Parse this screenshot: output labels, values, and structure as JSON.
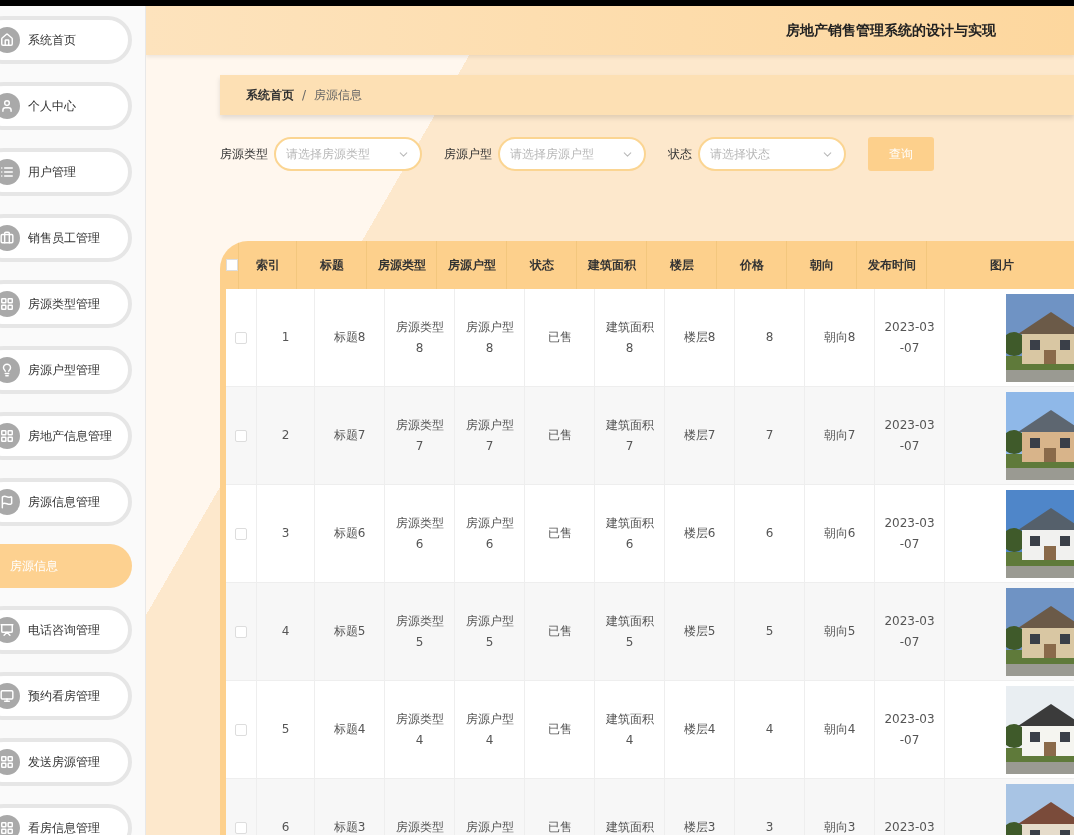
{
  "sidebar": {
    "items": [
      {
        "label": "系统首页",
        "selected": false
      },
      {
        "label": "个人中心",
        "selected": false
      },
      {
        "label": "用户管理",
        "selected": false
      },
      {
        "label": "销售员工管理",
        "selected": false
      },
      {
        "label": "房源类型管理",
        "selected": false
      },
      {
        "label": "房源户型管理",
        "selected": false
      },
      {
        "label": "房地产信息管理",
        "selected": false
      },
      {
        "label": "房源信息管理",
        "selected": false
      },
      {
        "label": "房源信息",
        "selected": true
      },
      {
        "label": "电话咨询管理",
        "selected": false
      },
      {
        "label": "预约看房管理",
        "selected": false
      },
      {
        "label": "发送房源管理",
        "selected": false
      },
      {
        "label": "看房信息管理",
        "selected": false
      }
    ]
  },
  "header": {
    "title": "房地产销售管理系统的设计与实现"
  },
  "breadcrumb": {
    "items": [
      "系统首页",
      "房源信息"
    ],
    "separator": "/"
  },
  "filters": [
    {
      "label": "房源类型",
      "placeholder": "请选择房源类型"
    },
    {
      "label": "房源户型",
      "placeholder": "请选择房源户型"
    },
    {
      "label": "状态",
      "placeholder": "请选择状态"
    }
  ],
  "search_button": "查询",
  "table": {
    "select_all_checked": false,
    "columns": [
      "索引",
      "标题",
      "房源类型",
      "房源户型",
      "状态",
      "建筑面积",
      "楼层",
      "价格",
      "朝向",
      "发布时间",
      "图片"
    ],
    "rows": [
      {
        "checked": false,
        "cells": [
          "1",
          "标题8",
          "房源类型8",
          "房源户型8",
          "已售",
          "建筑面积8",
          "楼层8",
          "8",
          "朝向8",
          "2023-03-07"
        ],
        "image": {
          "kind": "picture"
        }
      },
      {
        "checked": false,
        "cells": [
          "2",
          "标题7",
          "房源类型7",
          "房源户型7",
          "已售",
          "建筑面积7",
          "楼层7",
          "7",
          "朝向7",
          "2023-03-07"
        ],
        "image": {
          "kind": "picture"
        }
      },
      {
        "checked": false,
        "cells": [
          "3",
          "标题6",
          "房源类型6",
          "房源户型6",
          "已售",
          "建筑面积6",
          "楼层6",
          "6",
          "朝向6",
          "2023-03-07"
        ],
        "image": {
          "kind": "picture"
        }
      },
      {
        "checked": false,
        "cells": [
          "4",
          "标题5",
          "房源类型5",
          "房源户型5",
          "已售",
          "建筑面积5",
          "楼层5",
          "5",
          "朝向5",
          "2023-03-07"
        ],
        "image": {
          "kind": "picture"
        }
      },
      {
        "checked": false,
        "cells": [
          "5",
          "标题4",
          "房源类型4",
          "房源户型4",
          "已售",
          "建筑面积4",
          "楼层4",
          "4",
          "朝向4",
          "2023-03-07"
        ],
        "image": {
          "kind": "picture"
        }
      },
      {
        "checked": false,
        "cells": [
          "6",
          "标题3",
          "房源类型",
          "房源户型",
          "已售",
          "建筑面积",
          "楼层3",
          "3",
          "朝向3",
          "2023-03"
        ],
        "image": {
          "kind": "picture"
        }
      }
    ]
  }
}
